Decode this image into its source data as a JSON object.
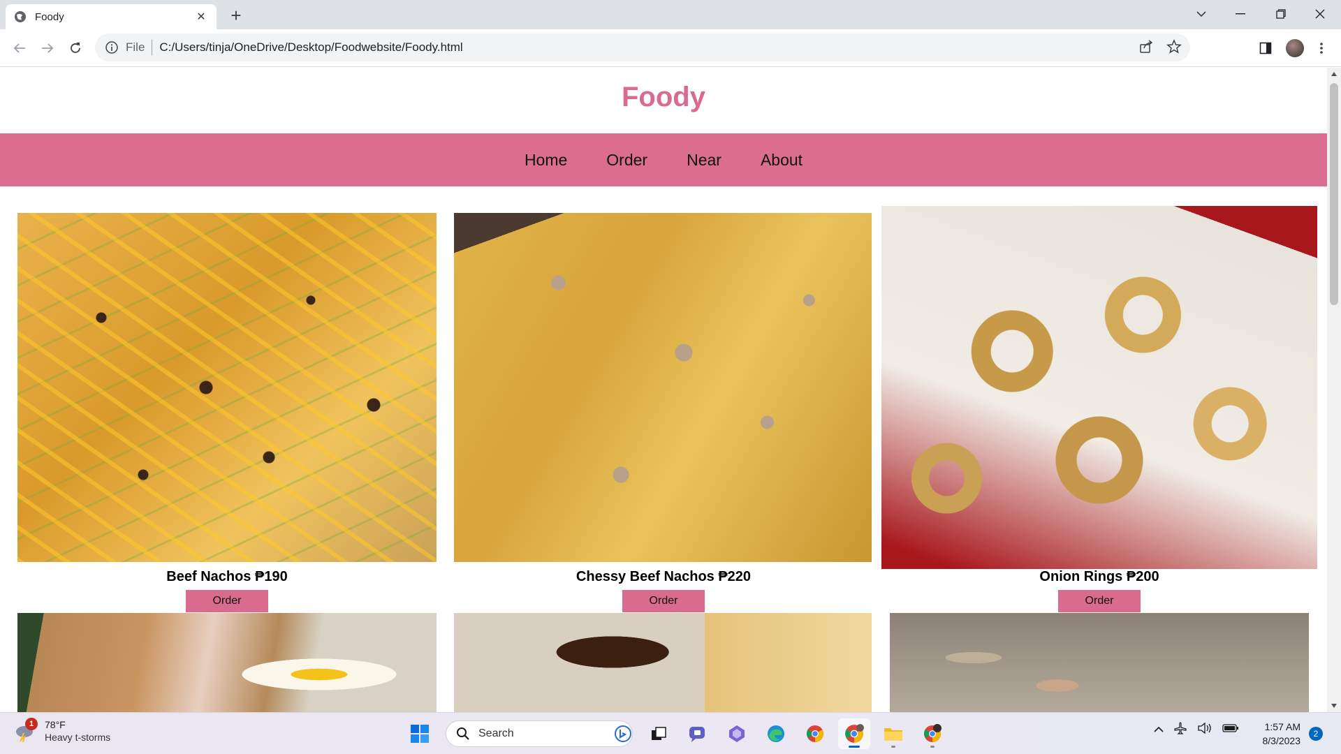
{
  "browser": {
    "tab_title": "Foody",
    "tab_close": "✕",
    "new_tab": "+",
    "omnibox": {
      "scheme_label": "File",
      "url": "C:/Users/tinja/OneDrive/Desktop/Foodwebsite/Foody.html"
    }
  },
  "site": {
    "title": "Foody",
    "nav": [
      "Home",
      "Order",
      "Near",
      "About"
    ],
    "accent_color": "#db6d8e",
    "products": [
      {
        "label": "Beef Nachos ₱190",
        "button": "Order",
        "image": "beef-nachos-photo"
      },
      {
        "label": "Chessy Beef Nachos ₱220",
        "button": "Order",
        "image": "cheesy-nachos-photo"
      },
      {
        "label": "Onion Rings ₱200",
        "button": "Order",
        "image": "onion-rings-photo"
      },
      {
        "image": "chicken-cutlet-egg-photo"
      },
      {
        "image": "glazed-wings-photo"
      },
      {
        "image": "takoyaki-photo"
      }
    ]
  },
  "taskbar": {
    "weather": {
      "badge": "1",
      "temp": "78°F",
      "condition": "Heavy t-storms"
    },
    "search_label": "Search",
    "clock": {
      "time": "1:57 AM",
      "date": "8/3/2023"
    },
    "notifications": "2"
  }
}
